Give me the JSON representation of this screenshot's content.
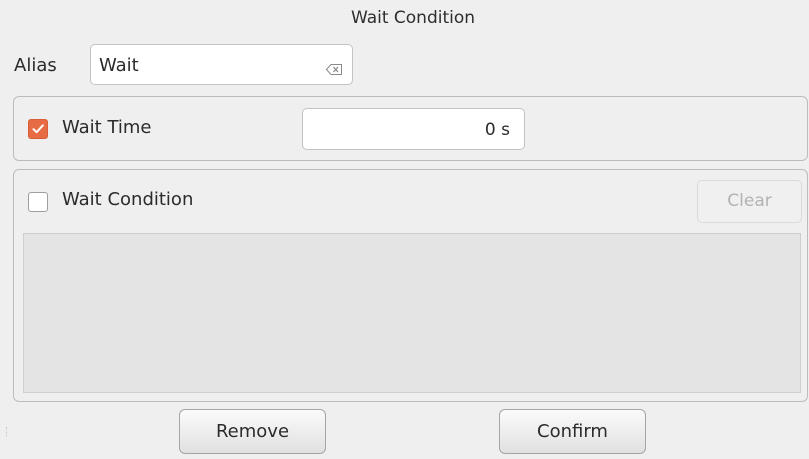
{
  "dialog": {
    "title": "Wait Condition"
  },
  "alias": {
    "label": "Alias",
    "value": "Wait",
    "clear_icon": "backspace-clear-icon"
  },
  "wait_time": {
    "label": "Wait Time",
    "checked": true,
    "value": "0 s"
  },
  "wait_condition": {
    "label": "Wait Condition",
    "checked": false,
    "clear_label": "Clear",
    "clear_enabled": false
  },
  "buttons": {
    "remove": "Remove",
    "confirm": "Confirm"
  },
  "colors": {
    "accent": "#e76c43",
    "background": "#efefef",
    "disabled_text": "#b2b2b2"
  }
}
